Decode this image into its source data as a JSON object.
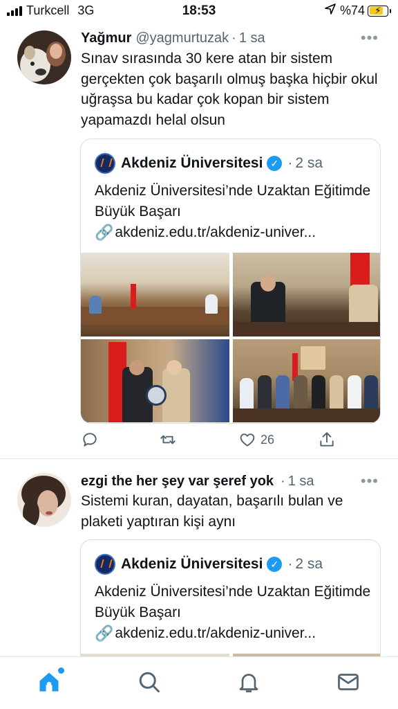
{
  "status_bar": {
    "carrier": "Turkcell",
    "network": "3G",
    "time": "18:53",
    "battery": "%74",
    "battery_level": 0.74
  },
  "tweets": [
    {
      "name": "Yağmur",
      "handle": "@yagmurtuzak",
      "separator": "·",
      "time": "1 sa",
      "text": "Sınav sırasında 30 kere atan bir sistem gerçekten çok başarılı olmuş başka hiçbir okul uğraşsa bu kadar çok kopan bir sistem yapamazdı helal olsun",
      "quote": {
        "name": "Akdeniz Üniversitesi",
        "separator": "·",
        "time": "2 sa",
        "text": "Akdeniz Üniversitesi’nde Uzaktan Eğitimde Büyük Başarı",
        "link": "akdeniz.edu.tr/akdeniz-univer..."
      },
      "actions": {
        "likes": "26"
      }
    },
    {
      "name": "ezgi the her şey var şeref yok",
      "separator": "·",
      "time": "1 sa",
      "text": "Sistemi kuran, dayatan, başarılı bulan ve plaketi yaptıran kişi aynı",
      "quote": {
        "name": "Akdeniz Üniversitesi",
        "separator": "·",
        "time": "2 sa",
        "text": "Akdeniz Üniversitesi’nde Uzaktan Eğitimde Büyük Başarı",
        "link": "akdeniz.edu.tr/akdeniz-univer..."
      }
    }
  ],
  "more_label": "•••",
  "icons": {
    "signal": "signal-icon",
    "location": "location-arrow-icon",
    "battery": "battery-charging-icon",
    "verified": "verified-badge-icon",
    "link": "link-icon",
    "reply": "reply-icon",
    "retweet": "retweet-icon",
    "like": "heart-icon",
    "share": "share-icon",
    "home": "home-icon",
    "search": "search-icon",
    "notifications": "bell-icon",
    "messages": "mail-icon"
  },
  "colors": {
    "accent": "#1d9bf0",
    "text": "#0f1419",
    "secondary": "#536471"
  }
}
